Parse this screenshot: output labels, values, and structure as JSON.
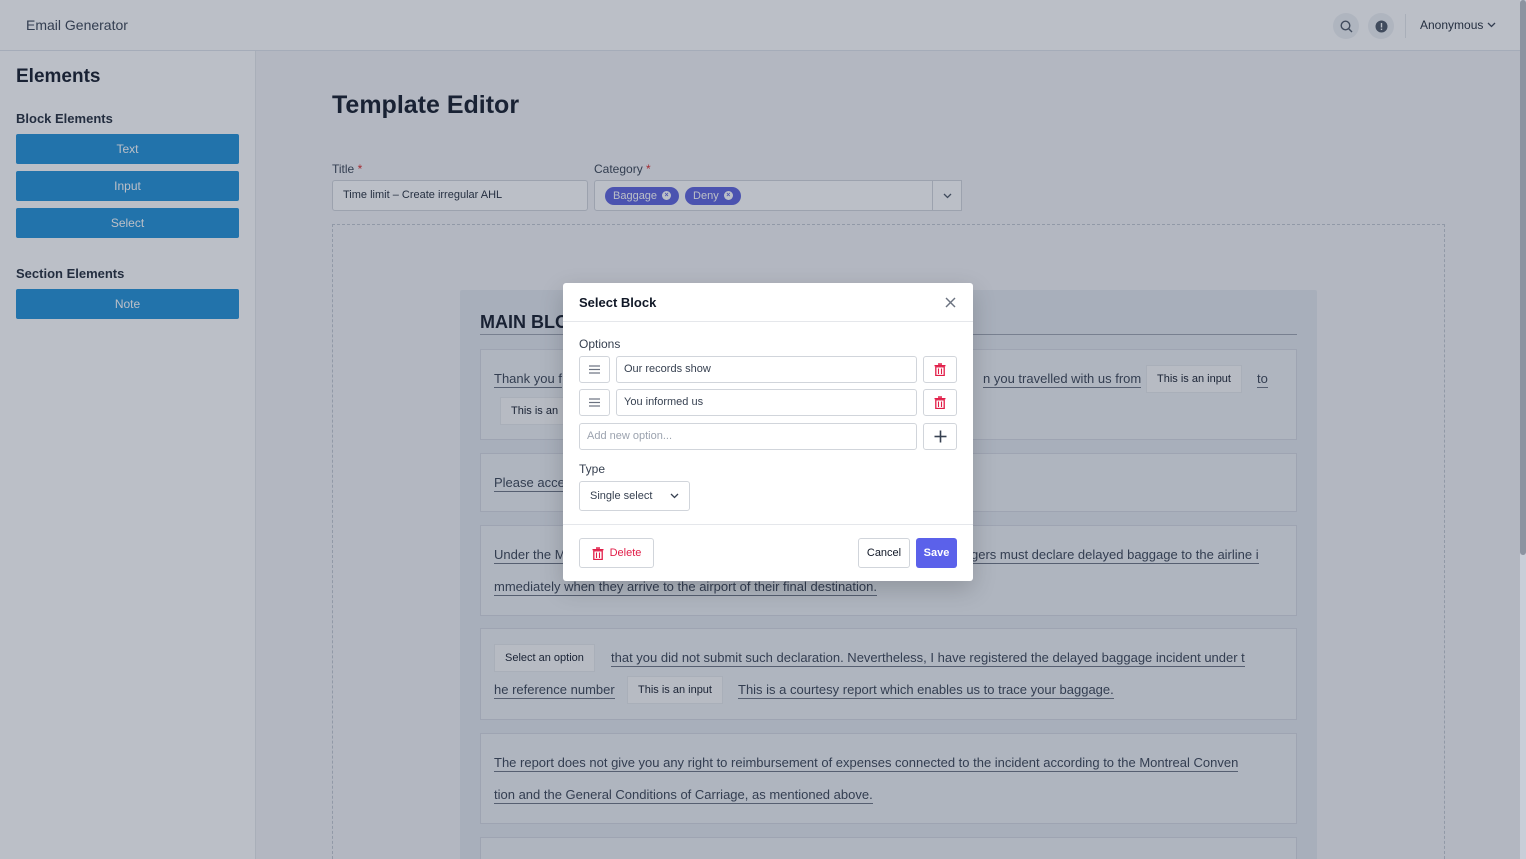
{
  "header": {
    "app_title": "Email Generator",
    "user_name": "Anonymous"
  },
  "sidebar": {
    "title": "Elements",
    "block_heading": "Block Elements",
    "block_items": [
      "Text",
      "Input",
      "Select"
    ],
    "section_heading": "Section Elements",
    "section_items": [
      "Note"
    ]
  },
  "editor": {
    "page_title": "Template Editor",
    "title_label": "Title",
    "title_value": "Time limit – Create irregular AHL",
    "category_label": "Category",
    "required_mark": "*",
    "categories": [
      "Baggage",
      "Deny"
    ],
    "main_block_title": "MAIN BLO",
    "paragraphs": {
      "p1_a": "Thank you f",
      "p1_b": "n you travelled with us from",
      "p1_input1": "This is an input",
      "p1_c": "to",
      "p1_input2": "This is an",
      "p2_a": "Please acce",
      "p3_a": "Under the M",
      "p3_b": "gers must declare delayed baggage to the airline i",
      "p3_c": "mmediately when they arrive to the airport of their final destination.",
      "p4_select": "Select an option",
      "p4_a": "that you did not submit such declaration. Nevertheless, I have registered the delayed baggage incident under t",
      "p4_b": "he reference number",
      "p4_input": "This is an input",
      "p4_c": "This is a courtesy report which enables us to trace your baggage.",
      "p5_a": "The report does not give you any right to reimbursement of expenses connected to the incident according to the Montreal Conven",
      "p5_b": "tion and the General Conditions of Carriage, as mentioned above."
    }
  },
  "modal": {
    "title": "Select Block",
    "options_label": "Options",
    "options": [
      "Our records show",
      "You informed us"
    ],
    "new_option_placeholder": "Add new option...",
    "type_label": "Type",
    "type_value": "Single select",
    "delete_label": "Delete",
    "cancel_label": "Cancel",
    "save_label": "Save"
  },
  "colors": {
    "accent": "#5b61ea",
    "sidebar_button": "#1e90d6",
    "danger": "#e11d48"
  },
  "icons": [
    "search-icon",
    "alert-icon",
    "chevron-down-icon",
    "close-icon",
    "drag-handle-icon",
    "trash-icon",
    "plus-icon"
  ]
}
